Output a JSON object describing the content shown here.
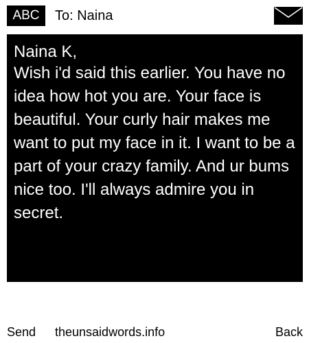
{
  "header": {
    "badge_label": "ABC",
    "to_field": "To: Naina",
    "icon": "envelope-icon"
  },
  "message": {
    "greeting": "Naina K,",
    "body": "Wish i'd said this earlier. You have no idea how hot you are. Your face is beautiful. Your curly hair makes me want to put my face in it. I want to be a part of your crazy family. And ur bums nice too. I'll always admire you in secret."
  },
  "footer": {
    "send_label": "Send",
    "site_label": "theunsaidwords.info",
    "back_label": "Back"
  },
  "colors": {
    "background": "#ffffff",
    "message_box": "#000000",
    "message_text": "#ffffff"
  }
}
